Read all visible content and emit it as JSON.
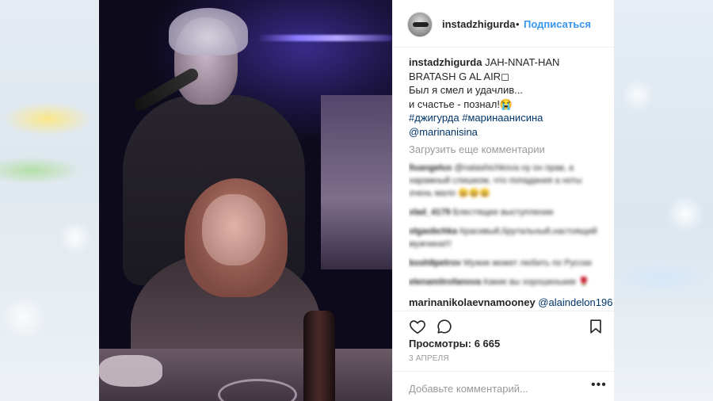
{
  "post": {
    "username": "instadzhigurda",
    "follow_separator": "•",
    "follow_label": "Подписаться"
  },
  "caption": {
    "username": "instadzhigurda",
    "line1": "JAH-NNAT-HAN BRATASH G AL AIR◻",
    "line2": "Был я смел и удачлив...",
    "line3": "и счастье - познал!😭",
    "hashtags": "#джигурда #маринаанисина",
    "mention": "@marinanisina"
  },
  "load_more_label": "Загрузить еще комментарии",
  "blurred_comments": [
    {
      "user": "lluangelus",
      "text": "@natashichkova ну он прав, а нарамный слишком, что попадания а ноты очень мало 😀😀😀"
    },
    {
      "user": "vlad_4179",
      "text": "Блестящее выступление"
    },
    {
      "user": "olgaobchka",
      "text": "Красивый,брутальный,настоящий мужчина!!!"
    },
    {
      "user": "bosh8petrov",
      "text": "Мужик может любить по Русски"
    },
    {
      "user": "elenamitrofanova",
      "text": "Какие вы хорошенькие 🌹"
    }
  ],
  "reply": {
    "username": "marinanikolaevnamooney",
    "mention": "@alaindelon196"
  },
  "stats": {
    "views_label": "Просмотры:",
    "views_value": "6 665",
    "date": "3 АПРЕЛЯ"
  },
  "comment_box": {
    "placeholder": "Добавьте комментарий...",
    "more_label": "•••"
  },
  "icons": {
    "like": "heart-icon",
    "comment": "comment-bubble-icon",
    "save": "bookmark-icon"
  }
}
